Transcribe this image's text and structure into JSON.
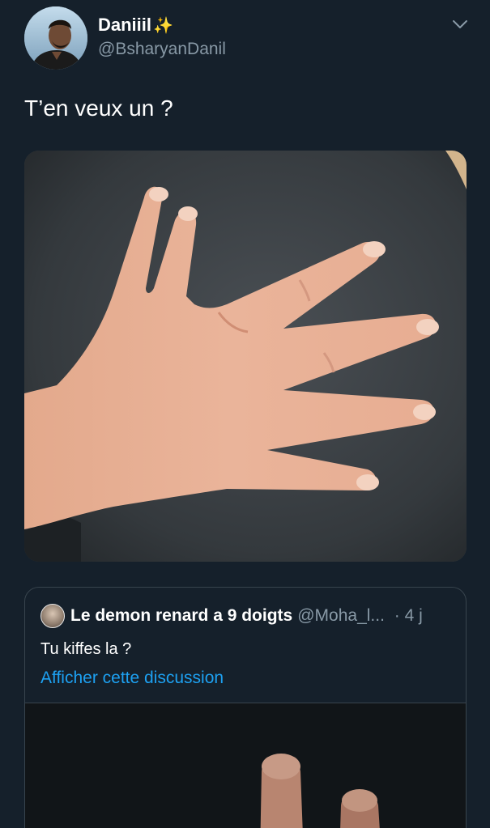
{
  "tweet": {
    "author_name": "Daniiil",
    "author_emoji": "✨",
    "author_handle": "@BsharyanDanil",
    "text": "T’en veux un ?",
    "media_icon": "photo-of-hand"
  },
  "quote": {
    "author_name": "Le demon renard a 9 doigts",
    "author_handle": "@Moha_l...",
    "timestamp": "· 4 j",
    "text": "Tu kiffes la ?",
    "show_thread": "Afficher cette discussion"
  },
  "colors": {
    "background": "#15202b",
    "secondary_text": "#8899a6",
    "link": "#1da1f2",
    "border": "#38444d"
  }
}
